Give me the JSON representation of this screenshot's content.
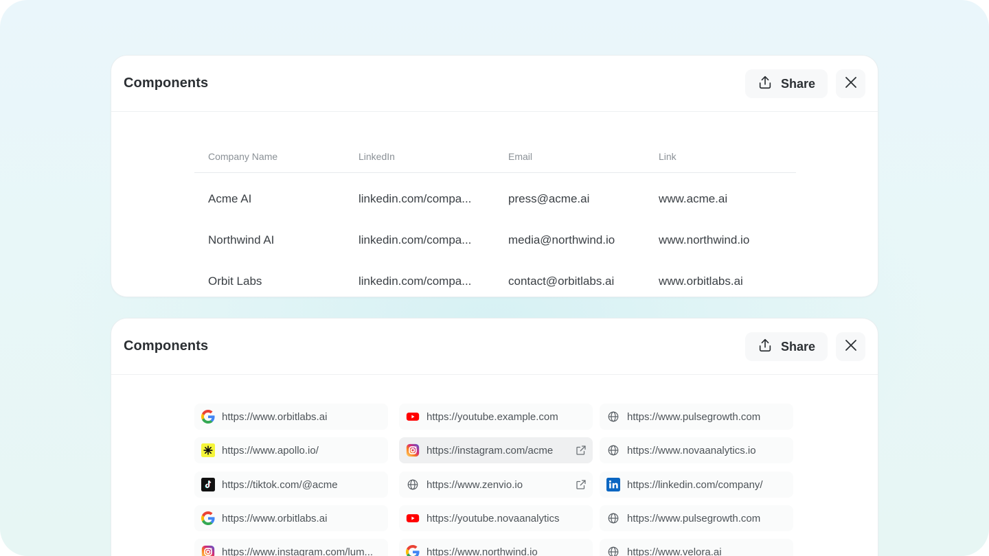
{
  "panel_top": {
    "title": "Components",
    "share_label": "Share",
    "table": {
      "headers": [
        "Company Name",
        "LinkedIn",
        "Email",
        "Link"
      ],
      "rows": [
        [
          "Acme AI",
          "linkedin.com/compa...",
          "press@acme.ai",
          "www.acme.ai"
        ],
        [
          "Northwind AI",
          "linkedin.com/compa...",
          "media@northwind.io",
          "www.northwind.io"
        ],
        [
          "Orbit Labs",
          "linkedin.com/compa...",
          "contact@orbitlabs.ai",
          "www.orbitlabs.ai"
        ]
      ]
    }
  },
  "panel_bottom": {
    "title": "Components",
    "share_label": "Share",
    "links": [
      {
        "icon": "google-icon",
        "url": "https://www.orbitlabs.ai"
      },
      {
        "icon": "youtube-icon",
        "url": "https://youtube.example.com"
      },
      {
        "icon": "globe-icon",
        "url": "https://www.pulsegrowth.com"
      },
      {
        "icon": "apollo-icon",
        "url": "https://www.apollo.io/"
      },
      {
        "icon": "instagram-icon",
        "url": "https://instagram.com/acme",
        "external": true,
        "active": true
      },
      {
        "icon": "globe-icon",
        "url": "https://www.novaanalytics.io"
      },
      {
        "icon": "tiktok-icon",
        "url": "https://tiktok.com/@acme"
      },
      {
        "icon": "globe-icon",
        "url": "https://www.zenvio.io",
        "external": true
      },
      {
        "icon": "linkedin-icon",
        "url": "https://linkedin.com/company/"
      },
      {
        "icon": "google-icon",
        "url": "https://www.orbitlabs.ai"
      },
      {
        "icon": "youtube-icon",
        "url": "https://youtube.novaanalytics"
      },
      {
        "icon": "globe-icon",
        "url": "https://www.pulsegrowth.com"
      },
      {
        "icon": "instagram-icon",
        "url": "https://www.instagram.com/lum..."
      },
      {
        "icon": "google-icon",
        "url": "https://www.northwind.io"
      },
      {
        "icon": "globe-icon",
        "url": "https://www.velora.ai"
      }
    ]
  },
  "colors": {
    "title_text": "#2b2f33",
    "muted_text": "#8a9096",
    "body_text": "#3a3f44",
    "youtube_red": "#ff0000",
    "linkedin_blue": "#0a66c2",
    "apollo_yellow": "#f5f53a"
  }
}
